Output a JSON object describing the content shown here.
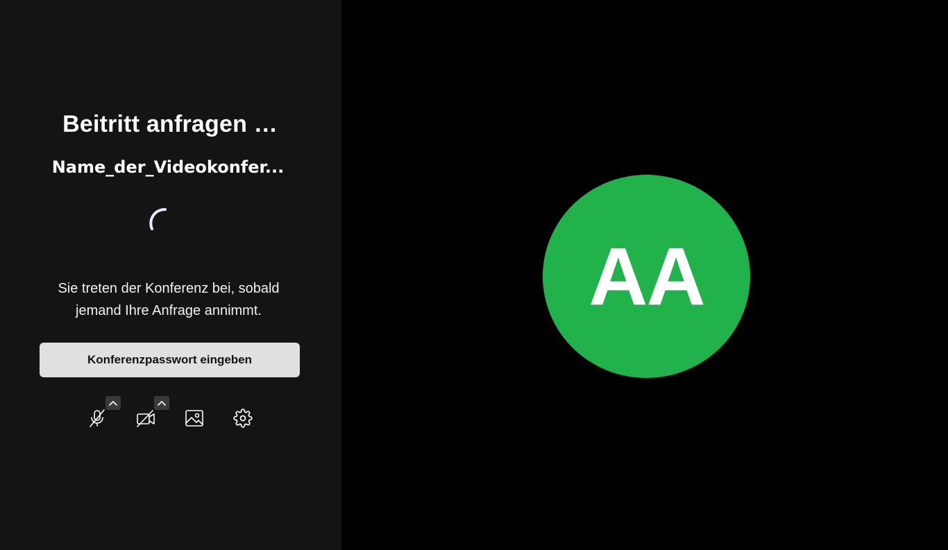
{
  "prejoin": {
    "title": "Beitritt anfragen …",
    "conference_name": "Name_der_Videokonfer...",
    "message_line1": "Sie treten der Konferenz bei, sobald",
    "message_line2": "jemand Ihre Anfrage annimmt.",
    "password_button_label": "Konferenzpasswort eingeben"
  },
  "toolbar": {
    "items": [
      {
        "name": "microphone-muted",
        "icon": "mic-off-icon",
        "has_options": true
      },
      {
        "name": "camera-off",
        "icon": "video-off-icon",
        "has_options": true
      },
      {
        "name": "virtual-background",
        "icon": "image-icon",
        "has_options": false
      },
      {
        "name": "settings",
        "icon": "gear-icon",
        "has_options": false
      }
    ]
  },
  "preview": {
    "avatar_initials": "AA"
  },
  "colors": {
    "left_panel_bg": "#141414",
    "right_panel_bg": "#000000",
    "avatar_bg": "#22b24c",
    "button_bg": "#e0e0e0",
    "caret_bg": "#3a3a3a"
  }
}
